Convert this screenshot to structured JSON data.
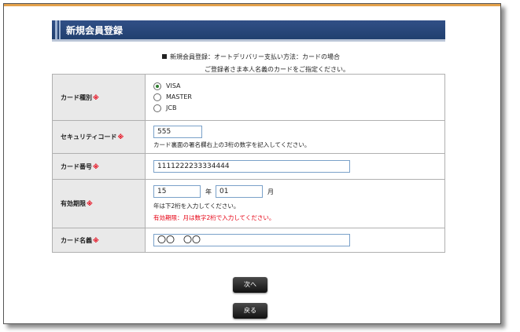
{
  "header": {
    "title": "新規会員登録"
  },
  "intro": {
    "line1": "新規会員登録：オートデリバリー支払い方法：カードの場合",
    "line2": "ご登録者さま本人名義のカードをご指定ください。"
  },
  "form": {
    "required_mark": "※",
    "card_type": {
      "label": "カード種別",
      "options": [
        "VISA",
        "MASTER",
        "JCB"
      ],
      "selected": "VISA"
    },
    "security_code": {
      "label": "セキュリティコード",
      "value": "555",
      "hint": "カード裏面の署名欄右上の3桁の数字を記入してください。"
    },
    "card_number": {
      "label": "カード番号",
      "value": "1111222233334444"
    },
    "expiry": {
      "label": "有効期限",
      "year_value": "15",
      "year_unit": "年",
      "month_value": "01",
      "month_unit": "月",
      "hint": "年は下2桁を入力してください。",
      "error": "有効期限：月は数字2桁で入力してください。"
    },
    "card_name": {
      "label": "カード名義",
      "value": "〇〇　〇〇"
    }
  },
  "buttons": {
    "next": "次へ",
    "back": "戻る"
  },
  "colors": {
    "header": "#2a4a7f",
    "required": "#e60012",
    "top_line": "#e3a14b"
  }
}
